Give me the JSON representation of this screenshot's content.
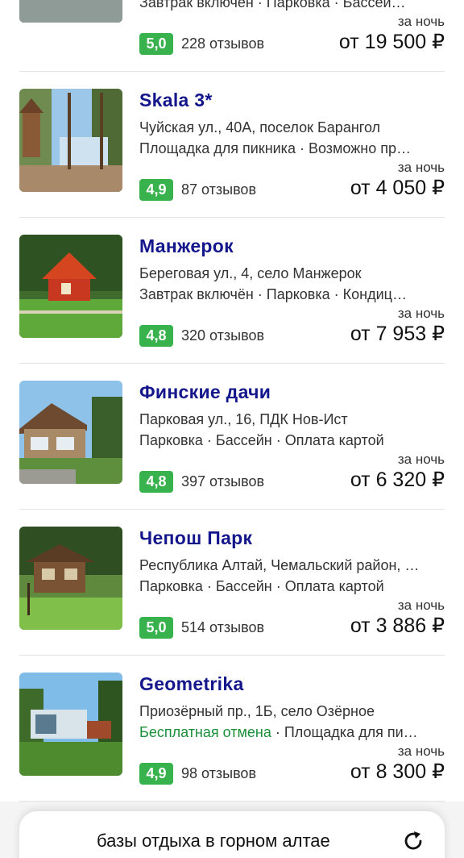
{
  "top_partial": {
    "features": "Завтрак включен · Парковка · Бассей…",
    "per_night": "за ночь",
    "score": "5,0",
    "reviews": "228 отзывов",
    "price": "от 19 500 ₽"
  },
  "hotels": [
    {
      "name": "Skala 3*",
      "address": "Чуйская ул., 40А, поселок Барангол",
      "features": "Площадка для пикника · Возможно пр…",
      "per_night": "за ночь",
      "score": "4,9",
      "reviews": "87 отзывов",
      "price": "от 4 050 ₽"
    },
    {
      "name": "Манжерок",
      "address": "Береговая ул., 4, село Манжерок",
      "features": "Завтрак включён · Парковка · Кондиц…",
      "per_night": "за ночь",
      "score": "4,8",
      "reviews": "320 отзывов",
      "price": "от 7 953 ₽"
    },
    {
      "name": "Финские дачи",
      "address": "Парковая ул., 16, ПДК Нов-Ист",
      "features": "Парковка · Бассейн · Оплата картой",
      "per_night": "за ночь",
      "score": "4,8",
      "reviews": "397 отзывов",
      "price": "от 6 320 ₽"
    },
    {
      "name": "Чепош Парк",
      "address": "Республика Алтай, Чемальский район, …",
      "features": "Парковка · Бассейн · Оплата картой",
      "per_night": "за ночь",
      "score": "5,0",
      "reviews": "514 отзывов",
      "price": "от 3 886 ₽"
    },
    {
      "name": "Geometrika",
      "address": "Приозёрный пр., 1Б, село Озёрное",
      "features_highlight": "Бесплатная отмена",
      "features": " · Площадка для пи…",
      "per_night": "за ночь",
      "score": "4,9",
      "reviews": "98 отзывов",
      "price": "от 8 300 ₽"
    }
  ],
  "search": {
    "query": "базы отдыха в горном алтае",
    "refresh_icon": "refresh-icon"
  },
  "colors": {
    "hotel_name": "#14168c",
    "score_badge": "#37b24d",
    "free_cancel": "#1a8f3a"
  }
}
